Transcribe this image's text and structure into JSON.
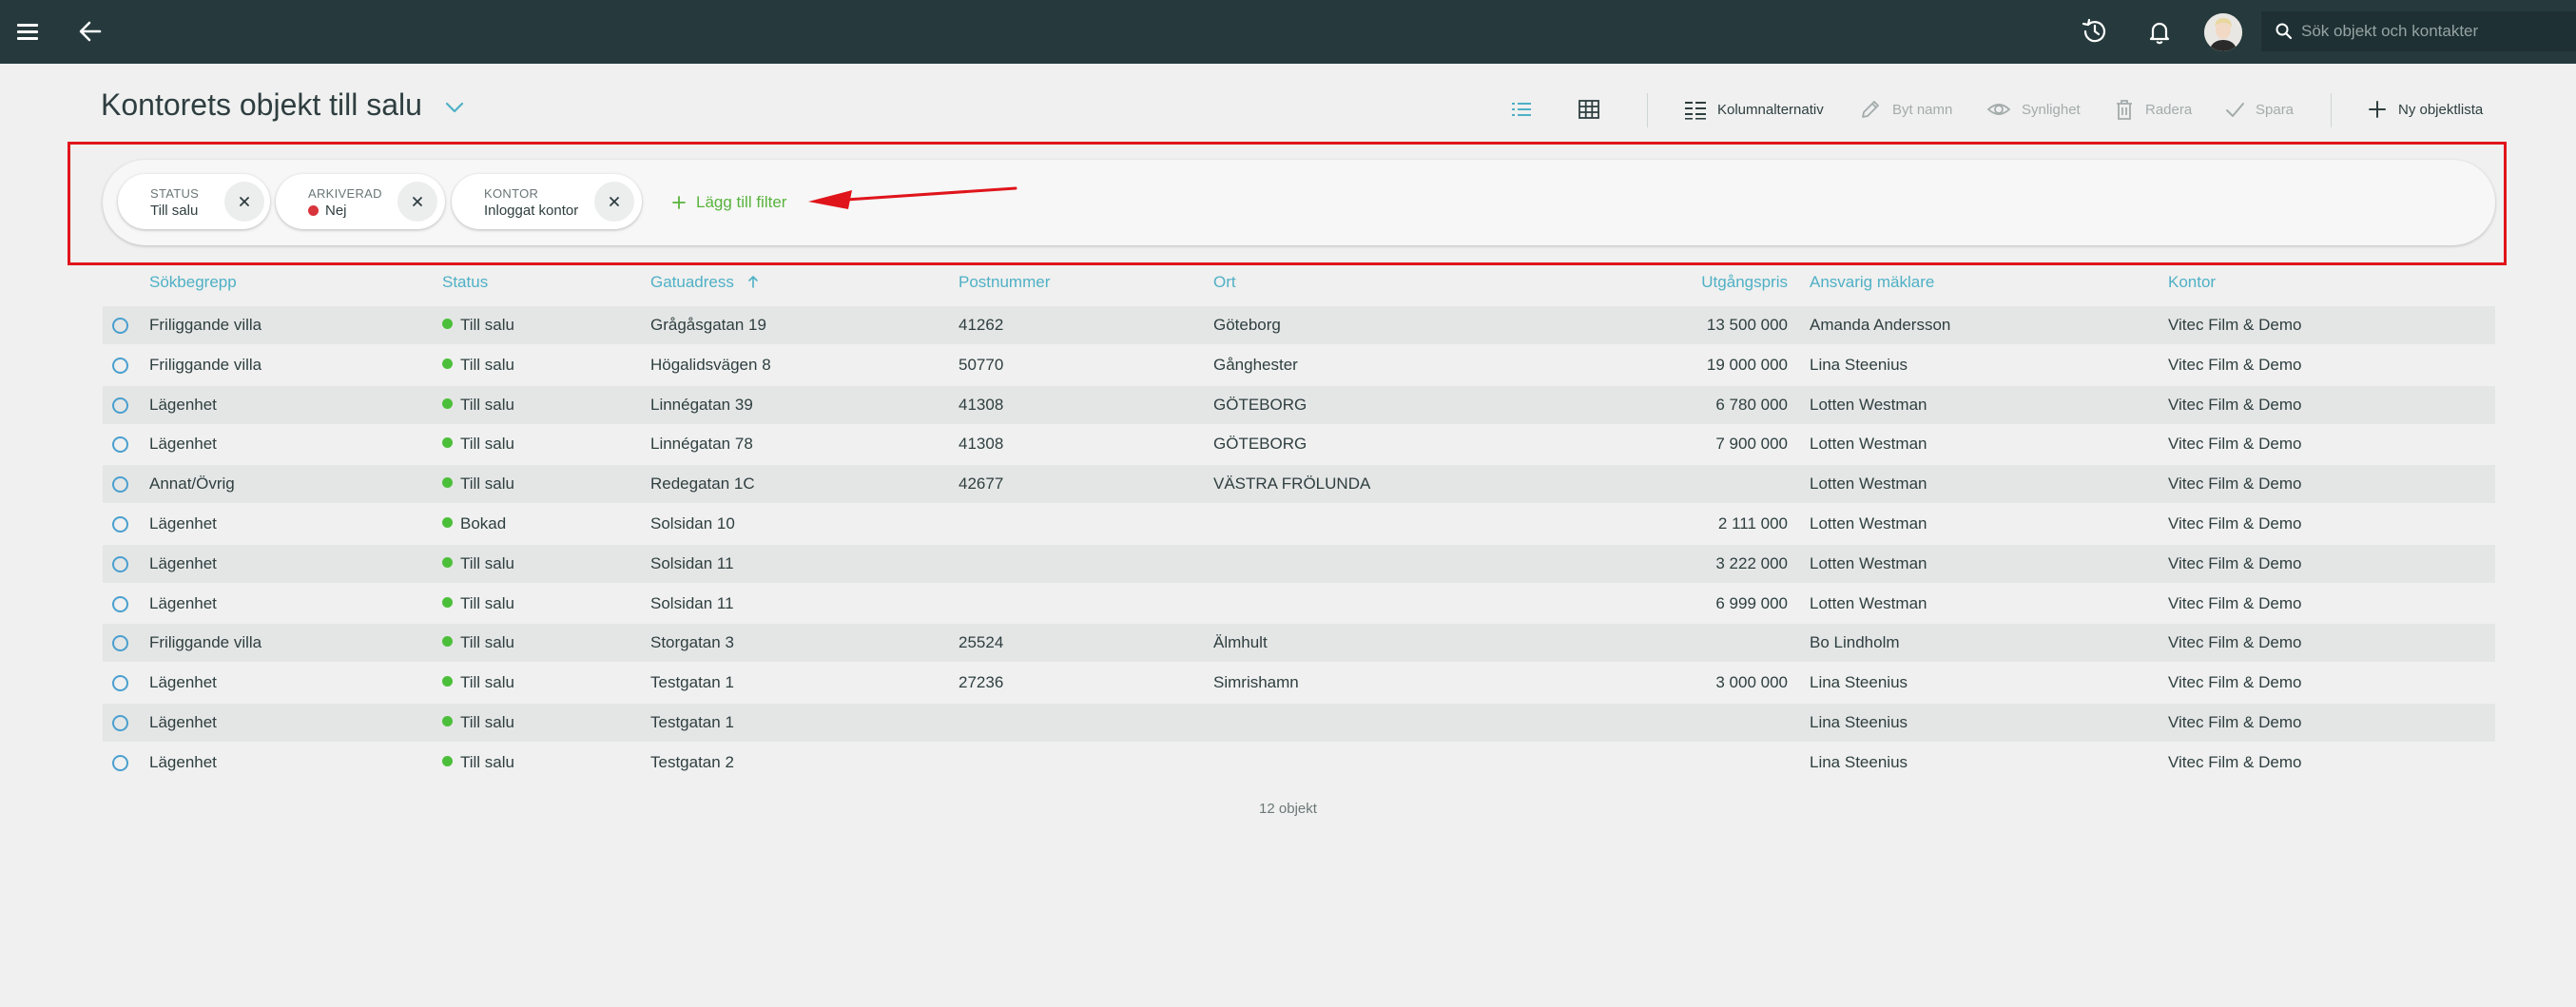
{
  "topbar": {
    "menu_icon": "hamburger-menu-icon",
    "back_icon": "arrow-left-icon",
    "history_icon": "history-clock-icon",
    "notification_icon": "bell-icon",
    "search_placeholder": "Sök objekt och kontakter"
  },
  "page": {
    "title": "Kontorets objekt till salu"
  },
  "toolbar": {
    "list_view_icon": "list-view-icon",
    "grid_view_icon": "grid-view-icon",
    "column_options": "Kolumnalternativ",
    "rename": "Byt namn",
    "visibility": "Synlighet",
    "delete": "Radera",
    "save": "Spara",
    "new_list": "Ny objektlista"
  },
  "filters": {
    "chips": [
      {
        "key": "STATUS",
        "value": "Till salu"
      },
      {
        "key": "ARKIVERAD",
        "value": "Nej",
        "dot_color": "#d8343c"
      },
      {
        "key": "KONTOR",
        "value": "Inloggat kontor"
      }
    ],
    "add_label": "Lägg till filter"
  },
  "table": {
    "columns": [
      "Sökbegrepp",
      "Status",
      "Gatuadress",
      "Postnummer",
      "Ort",
      "Utgångspris",
      "Ansvarig mäklare",
      "Kontor"
    ],
    "sorted_column": "Gatuadress",
    "sort_direction": "ascending",
    "rows": [
      [
        "Friliggande villa",
        "Till salu",
        "Grågåsgatan 19",
        "41262",
        "Göteborg",
        "13 500 000",
        "Amanda Andersson",
        "Vitec Film & Demo"
      ],
      [
        "Friliggande villa",
        "Till salu",
        "Högalidsvägen 8",
        "50770",
        "Gånghester",
        "19 000 000",
        "Lina Steenius",
        "Vitec Film & Demo"
      ],
      [
        "Lägenhet",
        "Till salu",
        "Linnégatan 39",
        "41308",
        "GÖTEBORG",
        "6 780 000",
        "Lotten Westman",
        "Vitec Film & Demo"
      ],
      [
        "Lägenhet",
        "Till salu",
        "Linnégatan 78",
        "41308",
        "GÖTEBORG",
        "7 900 000",
        "Lotten Westman",
        "Vitec Film & Demo"
      ],
      [
        "Annat/Övrig",
        "Till salu",
        "Redegatan 1C",
        "42677",
        "VÄSTRA FRÖLUNDA",
        "",
        "Lotten Westman",
        "Vitec Film & Demo"
      ],
      [
        "Lägenhet",
        "Bokad",
        "Solsidan 10",
        "",
        "",
        "2 111 000",
        "Lotten Westman",
        "Vitec Film & Demo"
      ],
      [
        "Lägenhet",
        "Till salu",
        "Solsidan 11",
        "",
        "",
        "3 222 000",
        "Lotten Westman",
        "Vitec Film & Demo"
      ],
      [
        "Lägenhet",
        "Till salu",
        "Solsidan 11",
        "",
        "",
        "6 999 000",
        "Lotten Westman",
        "Vitec Film & Demo"
      ],
      [
        "Friliggande villa",
        "Till salu",
        "Storgatan 3",
        "25524",
        "Älmhult",
        "",
        "Bo Lindholm",
        "Vitec Film & Demo"
      ],
      [
        "Lägenhet",
        "Till salu",
        "Testgatan 1",
        "27236",
        "Simrishamn",
        "3 000 000",
        "Lina Steenius",
        "Vitec Film & Demo"
      ],
      [
        "Lägenhet",
        "Till salu",
        "Testgatan 1",
        "",
        "",
        "",
        "Lina Steenius",
        "Vitec Film & Demo"
      ],
      [
        "Lägenhet",
        "Till salu",
        "Testgatan 2",
        "",
        "",
        "",
        "Lina Steenius",
        "Vitec Film & Demo"
      ]
    ],
    "status_colors": {
      "Till salu": "#4cbf3a",
      "Bokad": "#4cbf3a"
    }
  },
  "footer": {
    "count": "12 objekt"
  },
  "colors": {
    "topbar": "#263a3d",
    "accent_link": "#4fb0c6",
    "add_filter_green": "#59b33e",
    "annotation_red": "#e0141b"
  }
}
